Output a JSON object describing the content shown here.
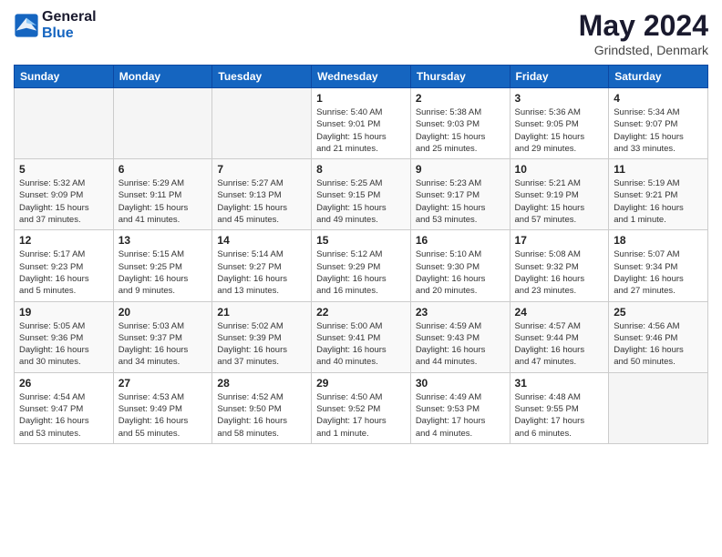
{
  "logo": {
    "line1": "General",
    "line2": "Blue"
  },
  "header": {
    "month": "May 2024",
    "location": "Grindsted, Denmark"
  },
  "weekdays": [
    "Sunday",
    "Monday",
    "Tuesday",
    "Wednesday",
    "Thursday",
    "Friday",
    "Saturday"
  ],
  "weeks": [
    [
      {
        "day": "",
        "info": ""
      },
      {
        "day": "",
        "info": ""
      },
      {
        "day": "",
        "info": ""
      },
      {
        "day": "1",
        "info": "Sunrise: 5:40 AM\nSunset: 9:01 PM\nDaylight: 15 hours\nand 21 minutes."
      },
      {
        "day": "2",
        "info": "Sunrise: 5:38 AM\nSunset: 9:03 PM\nDaylight: 15 hours\nand 25 minutes."
      },
      {
        "day": "3",
        "info": "Sunrise: 5:36 AM\nSunset: 9:05 PM\nDaylight: 15 hours\nand 29 minutes."
      },
      {
        "day": "4",
        "info": "Sunrise: 5:34 AM\nSunset: 9:07 PM\nDaylight: 15 hours\nand 33 minutes."
      }
    ],
    [
      {
        "day": "5",
        "info": "Sunrise: 5:32 AM\nSunset: 9:09 PM\nDaylight: 15 hours\nand 37 minutes."
      },
      {
        "day": "6",
        "info": "Sunrise: 5:29 AM\nSunset: 9:11 PM\nDaylight: 15 hours\nand 41 minutes."
      },
      {
        "day": "7",
        "info": "Sunrise: 5:27 AM\nSunset: 9:13 PM\nDaylight: 15 hours\nand 45 minutes."
      },
      {
        "day": "8",
        "info": "Sunrise: 5:25 AM\nSunset: 9:15 PM\nDaylight: 15 hours\nand 49 minutes."
      },
      {
        "day": "9",
        "info": "Sunrise: 5:23 AM\nSunset: 9:17 PM\nDaylight: 15 hours\nand 53 minutes."
      },
      {
        "day": "10",
        "info": "Sunrise: 5:21 AM\nSunset: 9:19 PM\nDaylight: 15 hours\nand 57 minutes."
      },
      {
        "day": "11",
        "info": "Sunrise: 5:19 AM\nSunset: 9:21 PM\nDaylight: 16 hours\nand 1 minute."
      }
    ],
    [
      {
        "day": "12",
        "info": "Sunrise: 5:17 AM\nSunset: 9:23 PM\nDaylight: 16 hours\nand 5 minutes."
      },
      {
        "day": "13",
        "info": "Sunrise: 5:15 AM\nSunset: 9:25 PM\nDaylight: 16 hours\nand 9 minutes."
      },
      {
        "day": "14",
        "info": "Sunrise: 5:14 AM\nSunset: 9:27 PM\nDaylight: 16 hours\nand 13 minutes."
      },
      {
        "day": "15",
        "info": "Sunrise: 5:12 AM\nSunset: 9:29 PM\nDaylight: 16 hours\nand 16 minutes."
      },
      {
        "day": "16",
        "info": "Sunrise: 5:10 AM\nSunset: 9:30 PM\nDaylight: 16 hours\nand 20 minutes."
      },
      {
        "day": "17",
        "info": "Sunrise: 5:08 AM\nSunset: 9:32 PM\nDaylight: 16 hours\nand 23 minutes."
      },
      {
        "day": "18",
        "info": "Sunrise: 5:07 AM\nSunset: 9:34 PM\nDaylight: 16 hours\nand 27 minutes."
      }
    ],
    [
      {
        "day": "19",
        "info": "Sunrise: 5:05 AM\nSunset: 9:36 PM\nDaylight: 16 hours\nand 30 minutes."
      },
      {
        "day": "20",
        "info": "Sunrise: 5:03 AM\nSunset: 9:37 PM\nDaylight: 16 hours\nand 34 minutes."
      },
      {
        "day": "21",
        "info": "Sunrise: 5:02 AM\nSunset: 9:39 PM\nDaylight: 16 hours\nand 37 minutes."
      },
      {
        "day": "22",
        "info": "Sunrise: 5:00 AM\nSunset: 9:41 PM\nDaylight: 16 hours\nand 40 minutes."
      },
      {
        "day": "23",
        "info": "Sunrise: 4:59 AM\nSunset: 9:43 PM\nDaylight: 16 hours\nand 44 minutes."
      },
      {
        "day": "24",
        "info": "Sunrise: 4:57 AM\nSunset: 9:44 PM\nDaylight: 16 hours\nand 47 minutes."
      },
      {
        "day": "25",
        "info": "Sunrise: 4:56 AM\nSunset: 9:46 PM\nDaylight: 16 hours\nand 50 minutes."
      }
    ],
    [
      {
        "day": "26",
        "info": "Sunrise: 4:54 AM\nSunset: 9:47 PM\nDaylight: 16 hours\nand 53 minutes."
      },
      {
        "day": "27",
        "info": "Sunrise: 4:53 AM\nSunset: 9:49 PM\nDaylight: 16 hours\nand 55 minutes."
      },
      {
        "day": "28",
        "info": "Sunrise: 4:52 AM\nSunset: 9:50 PM\nDaylight: 16 hours\nand 58 minutes."
      },
      {
        "day": "29",
        "info": "Sunrise: 4:50 AM\nSunset: 9:52 PM\nDaylight: 17 hours\nand 1 minute."
      },
      {
        "day": "30",
        "info": "Sunrise: 4:49 AM\nSunset: 9:53 PM\nDaylight: 17 hours\nand 4 minutes."
      },
      {
        "day": "31",
        "info": "Sunrise: 4:48 AM\nSunset: 9:55 PM\nDaylight: 17 hours\nand 6 minutes."
      },
      {
        "day": "",
        "info": ""
      }
    ]
  ]
}
